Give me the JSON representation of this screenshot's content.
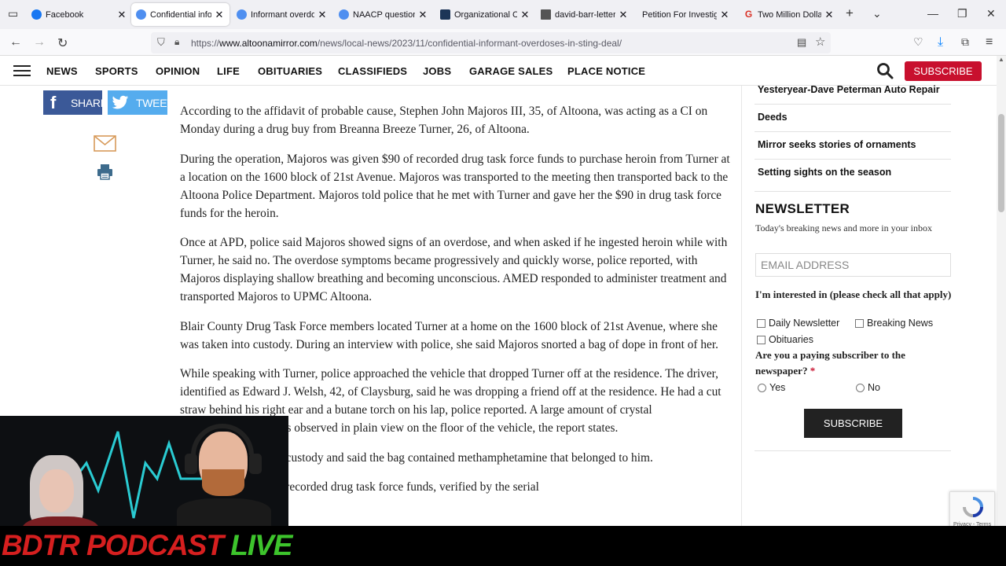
{
  "browser": {
    "tabs": [
      {
        "label": "Facebook",
        "color": "#1877f2",
        "active": false
      },
      {
        "label": "Confidential informant",
        "color": "#4f8ff0",
        "active": true
      },
      {
        "label": "Informant overdoses",
        "color": "#4f8ff0",
        "active": false
      },
      {
        "label": "NAACP questions",
        "color": "#4f8ff0",
        "active": false
      },
      {
        "label": "Organizational Ch",
        "color": "#1d3557",
        "active": false
      },
      {
        "label": "david-barr-letter.p",
        "color": "#555555",
        "active": false
      },
      {
        "label": "Petition For Investigati",
        "color": "#ffffff",
        "active": false
      },
      {
        "label": "Two Million Dolla",
        "color": "#d93025",
        "active": false
      }
    ],
    "url_domain": "www.altoonamirror.com",
    "url_prefix": "https://",
    "url_path": "/news/local-news/2023/11/confidential-informant-overdoses-in-sting-deal/"
  },
  "site": {
    "menu": [
      "NEWS",
      "SPORTS",
      "OPINION",
      "LIFE",
      "OBITUARIES",
      "CLASSIFIEDS",
      "JOBS",
      "GARAGE SALES",
      "PLACE NOTICE"
    ],
    "subscribe": "SUBSCRIBE",
    "brand_color": "#c8102e"
  },
  "share": {
    "facebook": "SHARE",
    "twitter": "TWEET"
  },
  "article": {
    "paragraphs": [
      "According to the affidavit of probable cause, Stephen John Majoros III, 35, of Altoona, was acting as a CI on Monday during a drug buy from Breanna Breeze Turner, 26, of Altoona.",
      "During the operation, Majoros was given $90 of recorded drug task force funds to purchase heroin from Turner at a location on the 1600 block of 21st Avenue. Majoros was transported to the meeting then transported back to the Altoona Police Department. Majoros told police that he met with Turner and gave her the $90 in drug task force funds for the heroin.",
      "Once at APD, police said Majoros showed signs of an overdose, and when asked if he ingested heroin while with Turner, he said no. The overdose symptoms became progressively and quickly worse, police reported, with Majoros displaying shallow breathing and becoming unconscious. AMED responded to administer treatment and transported Majoros to UPMC Altoona.",
      "Blair County Drug Task Force members located Turner at a home on the 1600 block of 21st Avenue, where she was taken into custody. During an interview with police, she said Majoros snorted a bag of dope in front of her.",
      "While speaking with Turner, police approached the vehicle that dropped Turner off at the residence. The driver, identified as Edward J. Welsh, 42, of Claysburg, said he was dropping a friend off at the residence. He had a cut straw behind his right ear and a butane torch on his lap, police reported. A large amount of crystal methamphetamine was observed in plain view on the floor of the vehicle, the report states.",
      "Welsh was taken into custody and said the bag contained methamphetamine that belonged to him.",
      "Welsh had $70 of the recorded drug task force funds, verified by the serial"
    ]
  },
  "sidebar": {
    "links": [
      "Yesteryear-Dave Peterman Auto Repair",
      "Deeds",
      "Mirror seeks stories of ornaments",
      "Setting sights on the season"
    ],
    "newsletter": {
      "title": "NEWSLETTER",
      "subtitle": "Today's breaking news and more in your inbox",
      "email_placeholder": "EMAIL ADDRESS",
      "interest_question": "I'm interested in (please check all that apply)",
      "options": [
        "Daily Newsletter",
        "Breaking News",
        "Obituaries"
      ],
      "paying_question": "Are you a paying subscriber to the newspaper?",
      "required_mark": "*",
      "yes": "Yes",
      "no": "No",
      "submit": "SUBSCRIBE"
    }
  },
  "recaptcha": {
    "text": "Privacy - Terms"
  },
  "overlay": {
    "podcast_name": "BDTR PODCAST",
    "live": "LIVE"
  }
}
